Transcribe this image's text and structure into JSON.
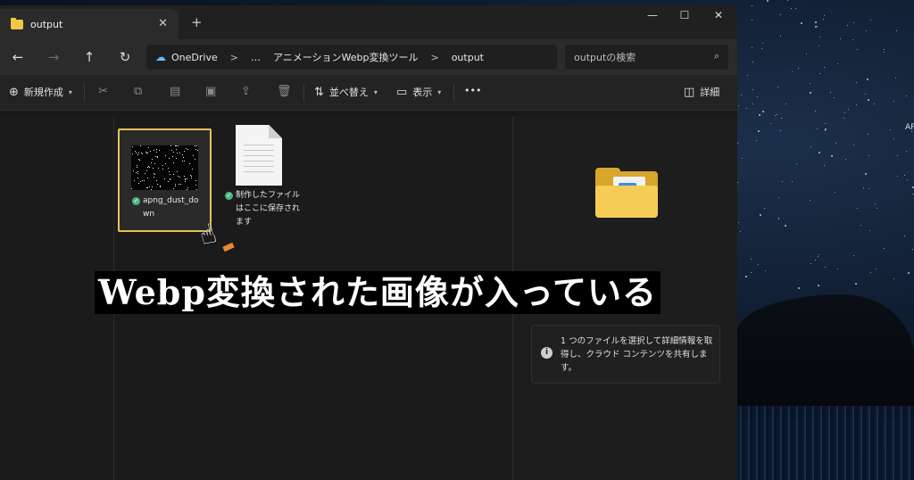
{
  "window": {
    "tab_title": "output",
    "tab_close": "✕",
    "new_tab": "+",
    "minimize": "—",
    "maximize": "☐",
    "close": "✕"
  },
  "nav": {
    "back": "←",
    "forward": "→",
    "up": "↑",
    "refresh": "↻"
  },
  "address": {
    "crumbs": [
      "OneDrive",
      "…",
      "アニメーションWebp変換ツール",
      "output"
    ],
    "separator": ">"
  },
  "search": {
    "placeholder": "outputの検索"
  },
  "toolbar": {
    "new_label": "新規作成",
    "sort_label": "並べ替え",
    "view_label": "表示",
    "more_label": "•••",
    "details_label": "詳細"
  },
  "files": [
    {
      "name_line1": "apng_dust_do",
      "name_line2": "wn",
      "status": "synced"
    },
    {
      "name_line1": "制作したファイル",
      "name_line2": "はここに保存され",
      "name_line3": "ます",
      "status": "synced"
    }
  ],
  "details_pane": {
    "info_text": "1 つのファイルを選択して詳細情報を取得し、クラウド コンテンツを共有します。"
  },
  "overlay": {
    "caption": "Webp変換された画像が入っている"
  },
  "desktop": {
    "label": "AP"
  },
  "colors": {
    "selection_border": "#e6c25a",
    "sync_check": "#4cb97a",
    "folder": "#f5cd56"
  }
}
